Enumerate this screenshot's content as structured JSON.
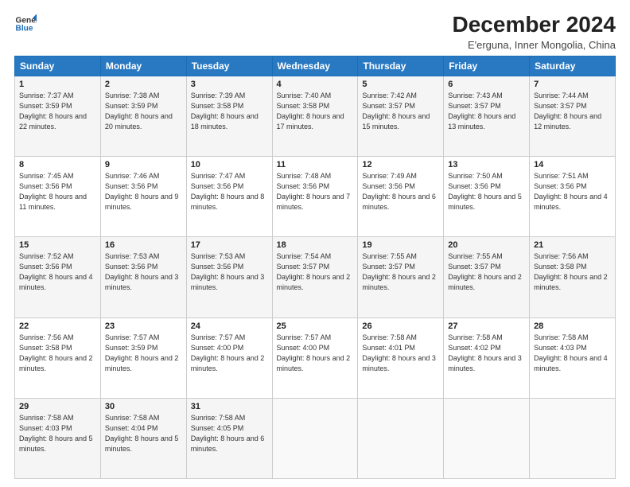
{
  "logo": {
    "line1": "General",
    "line2": "Blue",
    "icon_color": "#1a6cb5"
  },
  "title": "December 2024",
  "subtitle": "E'erguna, Inner Mongolia, China",
  "header": {
    "accent_color": "#2979c2"
  },
  "weekdays": [
    "Sunday",
    "Monday",
    "Tuesday",
    "Wednesday",
    "Thursday",
    "Friday",
    "Saturday"
  ],
  "weeks": [
    [
      {
        "day": "1",
        "sunrise": "Sunrise: 7:37 AM",
        "sunset": "Sunset: 3:59 PM",
        "daylight": "Daylight: 8 hours and 22 minutes."
      },
      {
        "day": "2",
        "sunrise": "Sunrise: 7:38 AM",
        "sunset": "Sunset: 3:59 PM",
        "daylight": "Daylight: 8 hours and 20 minutes."
      },
      {
        "day": "3",
        "sunrise": "Sunrise: 7:39 AM",
        "sunset": "Sunset: 3:58 PM",
        "daylight": "Daylight: 8 hours and 18 minutes."
      },
      {
        "day": "4",
        "sunrise": "Sunrise: 7:40 AM",
        "sunset": "Sunset: 3:58 PM",
        "daylight": "Daylight: 8 hours and 17 minutes."
      },
      {
        "day": "5",
        "sunrise": "Sunrise: 7:42 AM",
        "sunset": "Sunset: 3:57 PM",
        "daylight": "Daylight: 8 hours and 15 minutes."
      },
      {
        "day": "6",
        "sunrise": "Sunrise: 7:43 AM",
        "sunset": "Sunset: 3:57 PM",
        "daylight": "Daylight: 8 hours and 13 minutes."
      },
      {
        "day": "7",
        "sunrise": "Sunrise: 7:44 AM",
        "sunset": "Sunset: 3:57 PM",
        "daylight": "Daylight: 8 hours and 12 minutes."
      }
    ],
    [
      {
        "day": "8",
        "sunrise": "Sunrise: 7:45 AM",
        "sunset": "Sunset: 3:56 PM",
        "daylight": "Daylight: 8 hours and 11 minutes."
      },
      {
        "day": "9",
        "sunrise": "Sunrise: 7:46 AM",
        "sunset": "Sunset: 3:56 PM",
        "daylight": "Daylight: 8 hours and 9 minutes."
      },
      {
        "day": "10",
        "sunrise": "Sunrise: 7:47 AM",
        "sunset": "Sunset: 3:56 PM",
        "daylight": "Daylight: 8 hours and 8 minutes."
      },
      {
        "day": "11",
        "sunrise": "Sunrise: 7:48 AM",
        "sunset": "Sunset: 3:56 PM",
        "daylight": "Daylight: 8 hours and 7 minutes."
      },
      {
        "day": "12",
        "sunrise": "Sunrise: 7:49 AM",
        "sunset": "Sunset: 3:56 PM",
        "daylight": "Daylight: 8 hours and 6 minutes."
      },
      {
        "day": "13",
        "sunrise": "Sunrise: 7:50 AM",
        "sunset": "Sunset: 3:56 PM",
        "daylight": "Daylight: 8 hours and 5 minutes."
      },
      {
        "day": "14",
        "sunrise": "Sunrise: 7:51 AM",
        "sunset": "Sunset: 3:56 PM",
        "daylight": "Daylight: 8 hours and 4 minutes."
      }
    ],
    [
      {
        "day": "15",
        "sunrise": "Sunrise: 7:52 AM",
        "sunset": "Sunset: 3:56 PM",
        "daylight": "Daylight: 8 hours and 4 minutes."
      },
      {
        "day": "16",
        "sunrise": "Sunrise: 7:53 AM",
        "sunset": "Sunset: 3:56 PM",
        "daylight": "Daylight: 8 hours and 3 minutes."
      },
      {
        "day": "17",
        "sunrise": "Sunrise: 7:53 AM",
        "sunset": "Sunset: 3:56 PM",
        "daylight": "Daylight: 8 hours and 3 minutes."
      },
      {
        "day": "18",
        "sunrise": "Sunrise: 7:54 AM",
        "sunset": "Sunset: 3:57 PM",
        "daylight": "Daylight: 8 hours and 2 minutes."
      },
      {
        "day": "19",
        "sunrise": "Sunrise: 7:55 AM",
        "sunset": "Sunset: 3:57 PM",
        "daylight": "Daylight: 8 hours and 2 minutes."
      },
      {
        "day": "20",
        "sunrise": "Sunrise: 7:55 AM",
        "sunset": "Sunset: 3:57 PM",
        "daylight": "Daylight: 8 hours and 2 minutes."
      },
      {
        "day": "21",
        "sunrise": "Sunrise: 7:56 AM",
        "sunset": "Sunset: 3:58 PM",
        "daylight": "Daylight: 8 hours and 2 minutes."
      }
    ],
    [
      {
        "day": "22",
        "sunrise": "Sunrise: 7:56 AM",
        "sunset": "Sunset: 3:58 PM",
        "daylight": "Daylight: 8 hours and 2 minutes."
      },
      {
        "day": "23",
        "sunrise": "Sunrise: 7:57 AM",
        "sunset": "Sunset: 3:59 PM",
        "daylight": "Daylight: 8 hours and 2 minutes."
      },
      {
        "day": "24",
        "sunrise": "Sunrise: 7:57 AM",
        "sunset": "Sunset: 4:00 PM",
        "daylight": "Daylight: 8 hours and 2 minutes."
      },
      {
        "day": "25",
        "sunrise": "Sunrise: 7:57 AM",
        "sunset": "Sunset: 4:00 PM",
        "daylight": "Daylight: 8 hours and 2 minutes."
      },
      {
        "day": "26",
        "sunrise": "Sunrise: 7:58 AM",
        "sunset": "Sunset: 4:01 PM",
        "daylight": "Daylight: 8 hours and 3 minutes."
      },
      {
        "day": "27",
        "sunrise": "Sunrise: 7:58 AM",
        "sunset": "Sunset: 4:02 PM",
        "daylight": "Daylight: 8 hours and 3 minutes."
      },
      {
        "day": "28",
        "sunrise": "Sunrise: 7:58 AM",
        "sunset": "Sunset: 4:03 PM",
        "daylight": "Daylight: 8 hours and 4 minutes."
      }
    ],
    [
      {
        "day": "29",
        "sunrise": "Sunrise: 7:58 AM",
        "sunset": "Sunset: 4:03 PM",
        "daylight": "Daylight: 8 hours and 5 minutes."
      },
      {
        "day": "30",
        "sunrise": "Sunrise: 7:58 AM",
        "sunset": "Sunset: 4:04 PM",
        "daylight": "Daylight: 8 hours and 5 minutes."
      },
      {
        "day": "31",
        "sunrise": "Sunrise: 7:58 AM",
        "sunset": "Sunset: 4:05 PM",
        "daylight": "Daylight: 8 hours and 6 minutes."
      },
      null,
      null,
      null,
      null
    ]
  ]
}
